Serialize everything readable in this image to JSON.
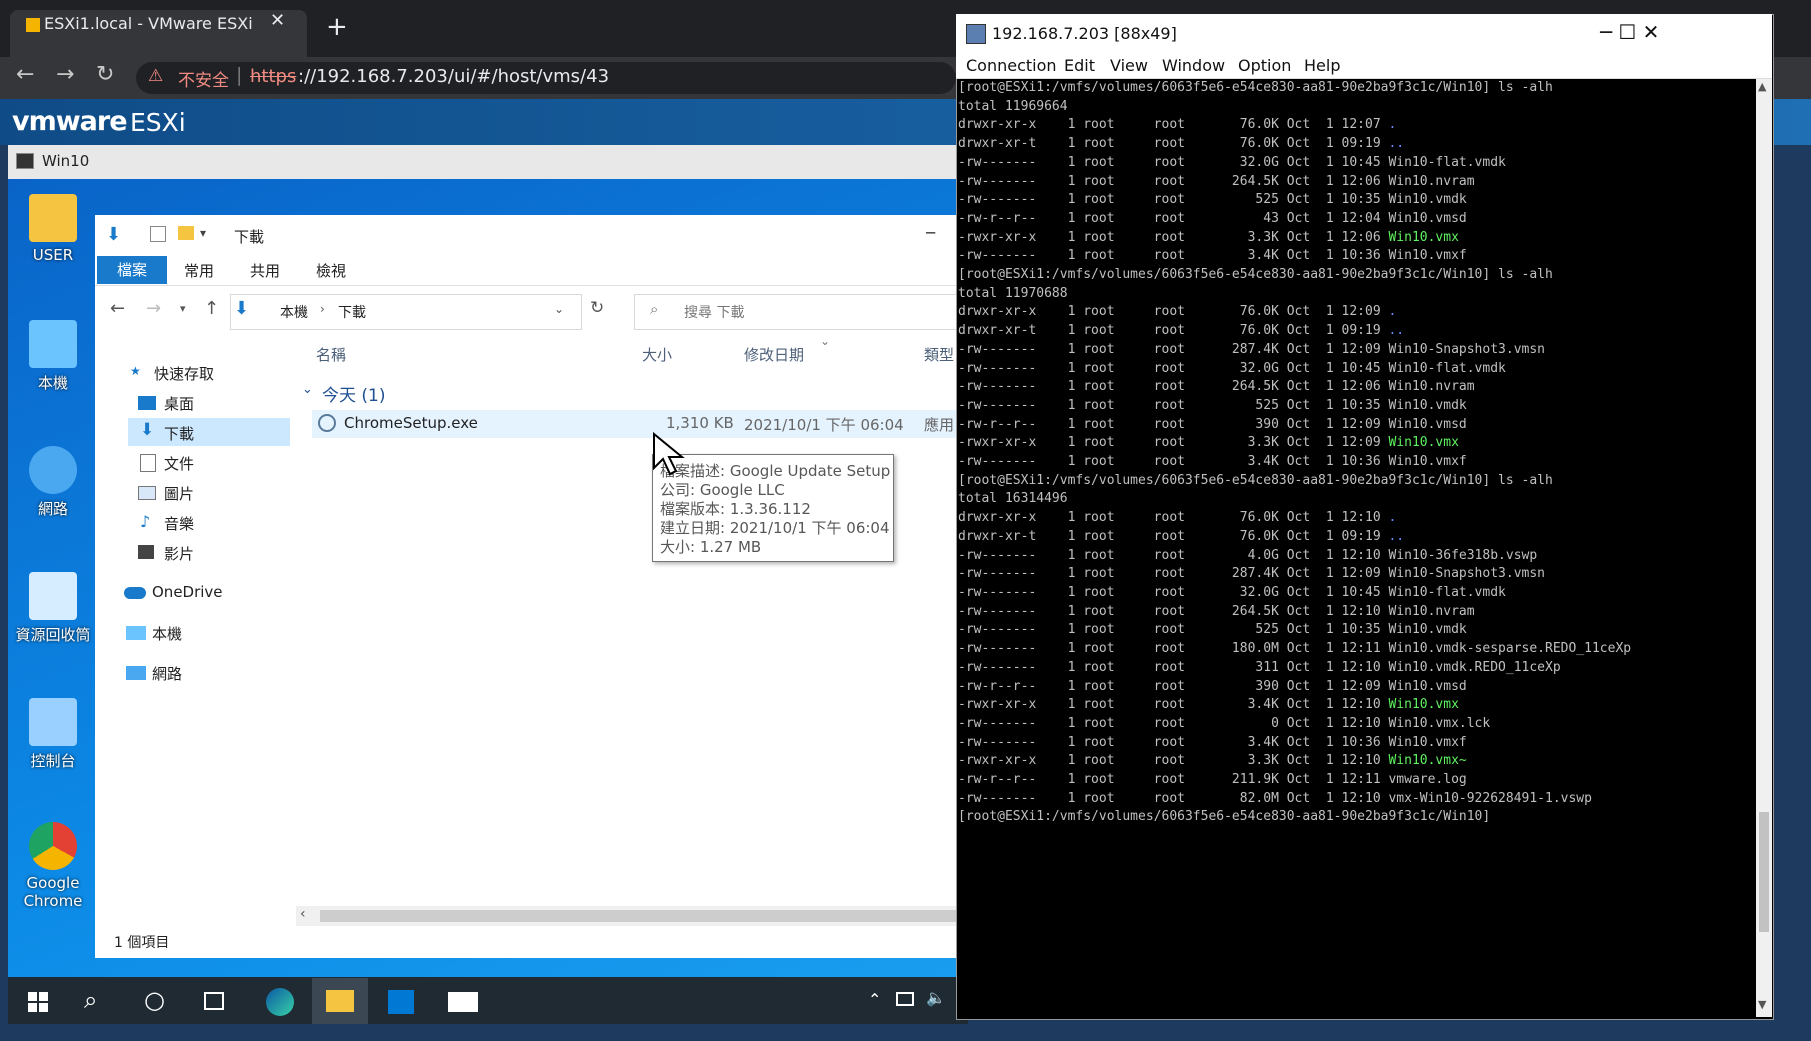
{
  "browser": {
    "tab_title": "ESXi1.local - VMware ESXi",
    "tab_close": "✕",
    "new_tab": "+",
    "back": "←",
    "forward": "→",
    "reload": "↻",
    "url_warning_icon": "⚠",
    "url_insecure_label": "不安全",
    "url_separator": "|",
    "url_scheme": "https",
    "url_rest": "://192.168.7.203/ui/#/host/vms/43"
  },
  "esxi": {
    "logo_vm": "vmware",
    "logo_product": "ESXi",
    "vm_name": "Win10"
  },
  "desktop": {
    "icons": [
      {
        "label": "USER",
        "icon": "user-folder-icon",
        "color": "#f5c542"
      },
      {
        "label": "本機",
        "icon": "this-pc-icon",
        "color": "#6cc4ff"
      },
      {
        "label": "網路",
        "icon": "network-icon",
        "color": "#4aa8f0"
      },
      {
        "label": "資源回收筒",
        "icon": "recycle-bin-icon",
        "color": "#d6ecff"
      },
      {
        "label": "控制台",
        "icon": "control-panel-icon",
        "color": "#9ad0ff"
      },
      {
        "label": "Google Chrome",
        "icon": "chrome-icon",
        "color": "#e34133"
      }
    ]
  },
  "explorer": {
    "title": "下載",
    "minimize": "─",
    "ribbon_tabs": [
      "檔案",
      "常用",
      "共用",
      "檢視"
    ],
    "address_path": [
      "本機",
      "下載"
    ],
    "search_placeholder": "搜尋 下載",
    "nav": {
      "quick_access": "快速存取",
      "items": [
        "桌面",
        "下載",
        "文件",
        "圖片",
        "音樂",
        "影片"
      ],
      "onedrive": "OneDrive",
      "this_pc": "本機",
      "network": "網路"
    },
    "columns": [
      "名稱",
      "大小",
      "修改日期",
      "類型"
    ],
    "group_label": "今天 (1)",
    "file": {
      "name": "ChromeSetup.exe",
      "size": "1,310 KB",
      "modified": "2021/10/1 下午 06:04",
      "type": "應用"
    },
    "tooltip": [
      "檔案描述: Google Update Setup",
      "公司: Google LLC",
      "檔案版本: 1.3.36.112",
      "建立日期: 2021/10/1 下午 06:04",
      "大小: 1.27 MB"
    ],
    "status": "1 個項目"
  },
  "putty": {
    "title": "192.168.7.203 [88x49]",
    "menu": [
      "Connection",
      "Edit",
      "View",
      "Window",
      "Option",
      "Help"
    ],
    "win_buttons": "─    ☐    ✕"
  }
}
